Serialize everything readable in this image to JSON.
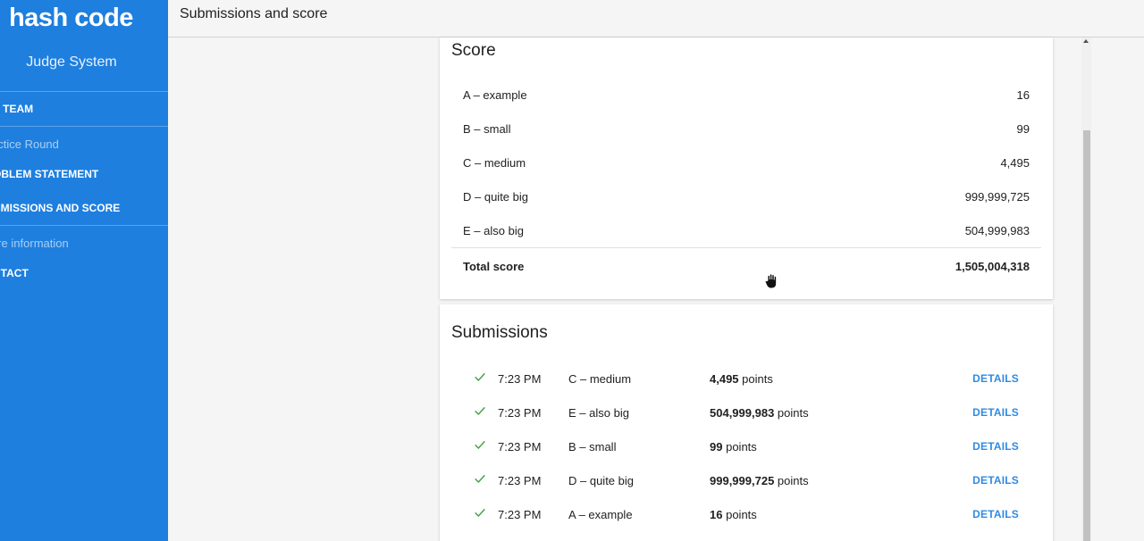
{
  "sidebar": {
    "logo": "hash code",
    "subtitle": "Judge System",
    "items": [
      {
        "label": "Y TEAM"
      },
      {
        "label": "OBLEM STATEMENT"
      },
      {
        "label": "BMISSIONS AND SCORE"
      },
      {
        "label": "NTACT"
      }
    ],
    "sections": [
      {
        "label": "actice Round"
      },
      {
        "label": "ore information"
      }
    ]
  },
  "topbar": {
    "title": "Submissions and score"
  },
  "score": {
    "title": "Score",
    "rows": [
      {
        "label": "A – example",
        "value": "16"
      },
      {
        "label": "B – small",
        "value": "99"
      },
      {
        "label": "C – medium",
        "value": "4,495"
      },
      {
        "label": "D – quite big",
        "value": "999,999,725"
      },
      {
        "label": "E – also big",
        "value": "504,999,983"
      }
    ],
    "total_label": "Total score",
    "total_value": "1,505,004,318"
  },
  "submissions": {
    "title": "Submissions",
    "points_suffix": "points",
    "details_label": "DETAILS",
    "rows": [
      {
        "time": "7:23 PM",
        "task": "C – medium",
        "points": "4,495"
      },
      {
        "time": "7:23 PM",
        "task": "E – also big",
        "points": "504,999,983"
      },
      {
        "time": "7:23 PM",
        "task": "B – small",
        "points": "99"
      },
      {
        "time": "7:23 PM",
        "task": "D – quite big",
        "points": "999,999,725"
      },
      {
        "time": "7:23 PM",
        "task": "A – example",
        "points": "16"
      }
    ]
  },
  "colors": {
    "sidebar": "#1e7fdf",
    "accent": "#2f8be3",
    "success": "#43a047"
  },
  "icons": {
    "status": "check-icon",
    "cursor": "hand-cursor-icon"
  }
}
